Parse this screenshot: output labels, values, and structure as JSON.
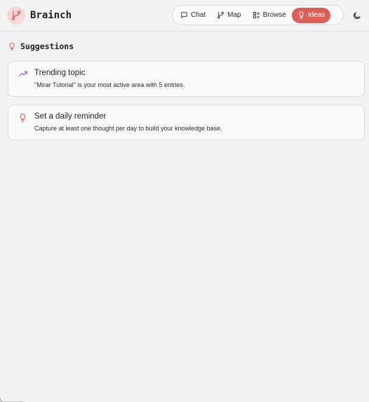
{
  "app": {
    "name": "Brainch"
  },
  "nav": {
    "items": [
      {
        "label": "Chat",
        "icon": "chat-bubble-icon"
      },
      {
        "label": "Map",
        "icon": "branch-icon"
      },
      {
        "label": "Browse",
        "icon": "list-icon"
      },
      {
        "label": "Ideas",
        "icon": "lightbulb-icon",
        "active": true
      }
    ]
  },
  "theme_toggle": {
    "icon": "moon-icon"
  },
  "suggestions": {
    "title": "Suggestions",
    "icon": "lightbulb-icon",
    "cards": [
      {
        "icon": "trending-up-icon",
        "title": "Trending topic",
        "description": "\"Mirar Tutorial\" is your most active area with 5 entries."
      },
      {
        "icon": "lightbulb-icon",
        "title": "Set a daily reminder",
        "description": "Capture at least one thought per day to build your knowledge base."
      }
    ]
  },
  "colors": {
    "accent": "#d95f57",
    "accent_soft": "#f6d9d7",
    "trend": "#9b59d6",
    "background": "#f2f2f2",
    "card": "#fafafa"
  }
}
